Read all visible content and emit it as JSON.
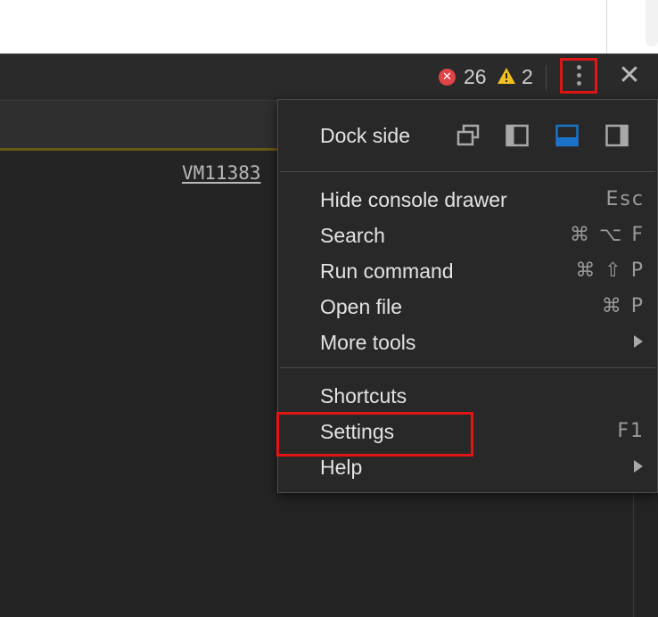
{
  "toolbar": {
    "error_count": "26",
    "warning_count": "2",
    "error_icon_glyph": "✕",
    "close_glyph": "✕",
    "colors": {
      "error": "#e04444",
      "warning": "#f0c020",
      "highlight": "#e01515",
      "active_dock": "#1a73c8"
    }
  },
  "console": {
    "source_link": "VM11383"
  },
  "menu": {
    "dock_side": {
      "label": "Dock side",
      "options": [
        {
          "icon": "undock-icon",
          "active": false
        },
        {
          "icon": "dock-left-icon",
          "active": false
        },
        {
          "icon": "dock-bottom-icon",
          "active": true
        },
        {
          "icon": "dock-right-icon",
          "active": false
        }
      ]
    },
    "group1": [
      {
        "label": "Hide console drawer",
        "shortcut": "Esc"
      },
      {
        "label": "Search",
        "shortcut": "⌘ ⌥ F"
      },
      {
        "label": "Run command",
        "shortcut": "⌘ ⇧ P"
      },
      {
        "label": "Open file",
        "shortcut": "⌘ P"
      },
      {
        "label": "More tools",
        "submenu": true
      }
    ],
    "group2": [
      {
        "label": "Shortcuts",
        "shortcut": ""
      },
      {
        "label": "Settings",
        "shortcut": "F1"
      },
      {
        "label": "Help",
        "submenu": true
      }
    ]
  }
}
